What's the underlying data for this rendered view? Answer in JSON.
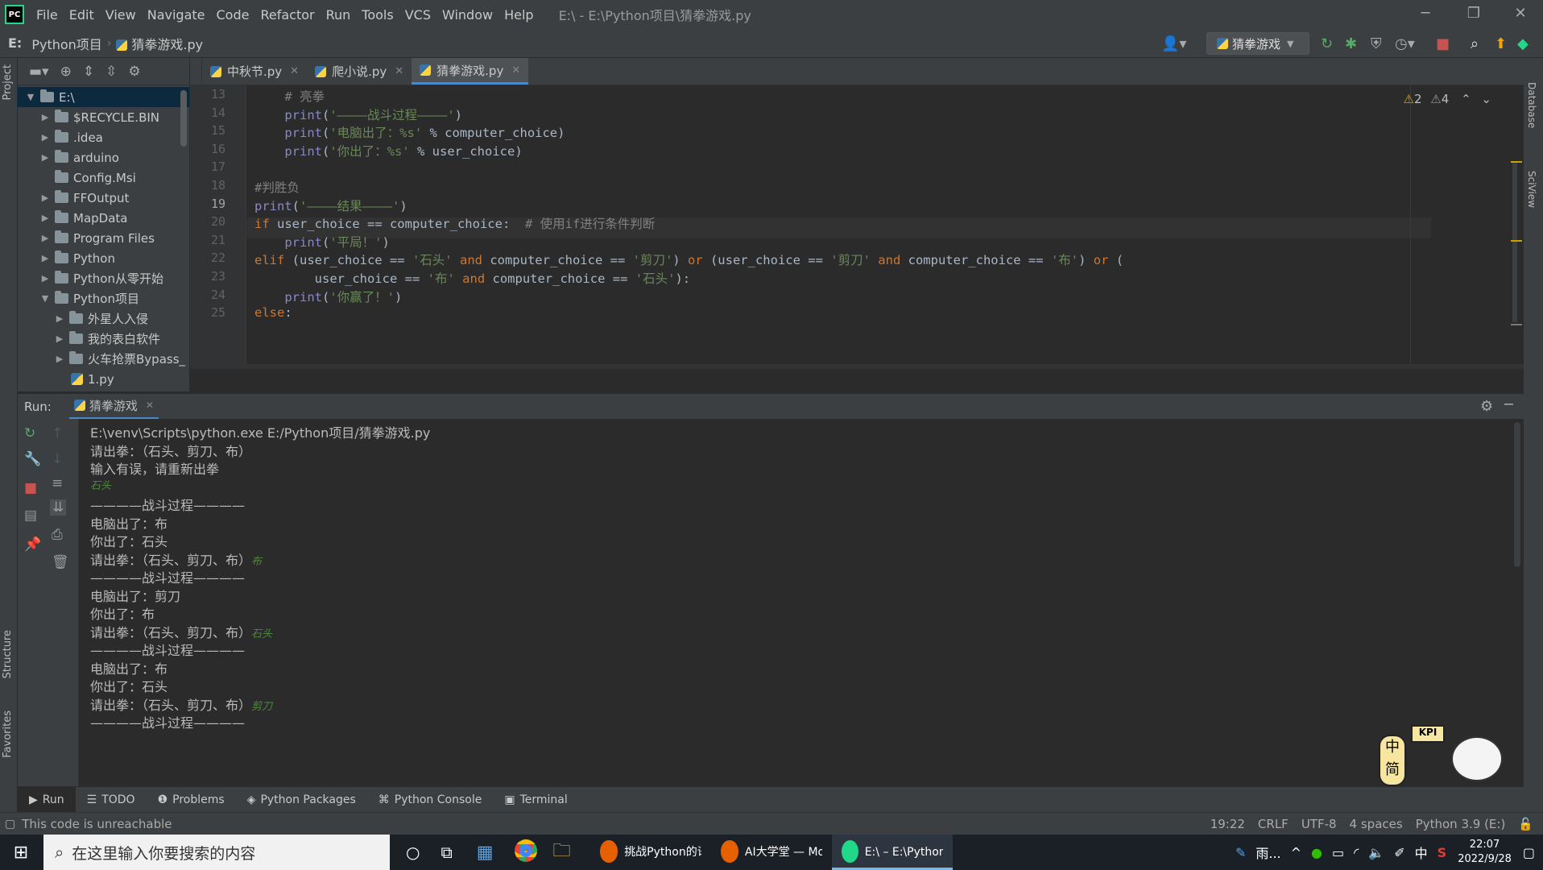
{
  "menubar": {
    "items": [
      "File",
      "Edit",
      "View",
      "Navigate",
      "Code",
      "Refactor",
      "Run",
      "Tools",
      "VCS",
      "Window",
      "Help"
    ],
    "window_title": "E:\\ - E:\\Python项目\\猜拳游戏.py"
  },
  "navbar": {
    "crumbs": [
      "E:",
      "Python项目",
      "猜拳游戏.py"
    ],
    "run_config": "猜拳游戏"
  },
  "left_strip": {
    "project": "Project",
    "structure": "Structure",
    "favorites": "Favorites"
  },
  "right_strip": {
    "database": "Database",
    "sciview": "SciView"
  },
  "project_tree": [
    {
      "label": "E:\\",
      "depth": 0,
      "expanded": true,
      "type": "folder",
      "selected": true
    },
    {
      "label": "$RECYCLE.BIN",
      "depth": 1,
      "type": "folder"
    },
    {
      "label": ".idea",
      "depth": 1,
      "type": "folder"
    },
    {
      "label": "arduino",
      "depth": 1,
      "type": "folder"
    },
    {
      "label": "Config.Msi",
      "depth": 1,
      "type": "folder",
      "leaf": true
    },
    {
      "label": "FFOutput",
      "depth": 1,
      "type": "folder"
    },
    {
      "label": "MapData",
      "depth": 1,
      "type": "folder"
    },
    {
      "label": "Program Files",
      "depth": 1,
      "type": "folder"
    },
    {
      "label": "Python",
      "depth": 1,
      "type": "folder"
    },
    {
      "label": "Python从零开始",
      "depth": 1,
      "type": "folder"
    },
    {
      "label": "Python项目",
      "depth": 1,
      "type": "folder",
      "expanded": true
    },
    {
      "label": "外星人入侵",
      "depth": 2,
      "type": "folder"
    },
    {
      "label": "我的表白软件",
      "depth": 2,
      "type": "folder"
    },
    {
      "label": "火车抢票Bypass_",
      "depth": 2,
      "type": "folder"
    },
    {
      "label": "1.py",
      "depth": 2,
      "type": "py",
      "leaf": true
    }
  ],
  "tabs": [
    {
      "label": "中秋节.py",
      "active": false
    },
    {
      "label": "爬小说.py",
      "active": false
    },
    {
      "label": "猜拳游戏.py",
      "active": true
    }
  ],
  "editor": {
    "warnings": "2",
    "weak_warnings": "4",
    "current_line": "19",
    "line_numbers": [
      "13",
      "14",
      "15",
      "16",
      "17",
      "18",
      "19",
      "20",
      "21",
      "22",
      "23",
      "24",
      "25"
    ],
    "code_lines": [
      "    # 亮拳",
      "    print('————战斗过程————')",
      "    print('电脑出了：%s' % computer_choice)",
      "    print('你出了：%s' % user_choice)",
      "",
      "#判胜负",
      "print('————结果————')",
      "if user_choice == computer_choice:  # 使用if进行条件判断",
      "    print('平局！')",
      "elif (user_choice == '石头' and computer_choice == '剪刀') or (user_choice == '剪刀' and computer_choice == '布') or (",
      "        user_choice == '布' and computer_choice == '石头'):",
      "    print('你赢了！')",
      "else:"
    ]
  },
  "run": {
    "label": "Run:",
    "tab": "猜拳游戏",
    "output": [
      {
        "text": "E:\\venv\\Scripts\\python.exe E:/Python项目/猜拳游戏.py"
      },
      {
        "text": "请出拳：（石头、剪刀、布）"
      },
      {
        "text": "输入有误，请重新出拳"
      },
      {
        "text": "",
        "input": "石头"
      },
      {
        "text": "————战斗过程————"
      },
      {
        "text": "电脑出了：布"
      },
      {
        "text": "你出了：石头"
      },
      {
        "text": "请出拳：（石头、剪刀、布）",
        "input": "布"
      },
      {
        "text": "————战斗过程————"
      },
      {
        "text": "电脑出了：剪刀"
      },
      {
        "text": "你出了：布"
      },
      {
        "text": "请出拳：（石头、剪刀、布）",
        "input": "石头"
      },
      {
        "text": "————战斗过程————"
      },
      {
        "text": "电脑出了：布"
      },
      {
        "text": "你出了：石头"
      },
      {
        "text": "请出拳：（石头、剪刀、布）",
        "input": "剪刀"
      },
      {
        "text": "————战斗过程————"
      }
    ]
  },
  "tool_windows": [
    "Run",
    "TODO",
    "Problems",
    "Python Packages",
    "Python Console",
    "Terminal"
  ],
  "status": {
    "message": "This code is unreachable",
    "position": "19:22",
    "line_sep": "CRLF",
    "encoding": "UTF-8",
    "indent": "4 spaces",
    "interpreter": "Python 3.9 (E:)"
  },
  "taskbar": {
    "search_placeholder": "在这里输入你要搜索的内容",
    "apps": [
      {
        "label": "挑战Python的语...",
        "color": "#e66000"
      },
      {
        "label": "AI大学堂 — Moz...",
        "color": "#e66000"
      },
      {
        "label": "E:\\ – E:\\Python项...",
        "color": "#21d789",
        "active": true
      }
    ],
    "weather": "雨...",
    "ime": "中",
    "time": "22:07",
    "date": "2022/9/28"
  },
  "overlay_badge": {
    "top": "KPI",
    "chars": "中简"
  },
  "colors": {
    "keyword": "#cc7832",
    "string": "#6a8759",
    "comment": "#808080",
    "accent": "#4a88c7"
  }
}
